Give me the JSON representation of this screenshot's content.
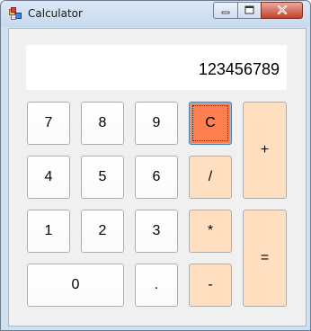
{
  "window": {
    "title": "Calculator",
    "minimize_icon": "minimize-icon",
    "maximize_icon": "maximize-icon",
    "close_icon": "close-icon",
    "app_icon": "calculator-app-icon"
  },
  "display": {
    "value": "123456789"
  },
  "keys": {
    "k7": "7",
    "k8": "8",
    "k9": "9",
    "clear": "C",
    "plus": "+",
    "k4": "4",
    "k5": "5",
    "k6": "6",
    "divide": "/",
    "k1": "1",
    "k2": "2",
    "k3": "3",
    "multiply": "*",
    "equals": "=",
    "k0": "0",
    "dot": ".",
    "minus": "-"
  },
  "colors": {
    "operator_bg": "#ffdfbf",
    "clear_bg": "#ff7f50",
    "close_button": "#c4412c"
  }
}
